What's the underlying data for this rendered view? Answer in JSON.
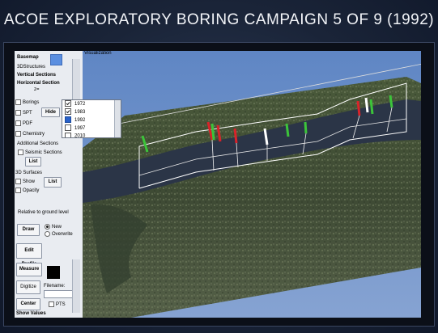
{
  "slide_title": "ACOE EXPLORATORY BORING CAMPAIGN 5  OF 9  (1992)",
  "view": {
    "title": "Visualization"
  },
  "panel": {
    "basemap": "Basemap",
    "structures3d": "3DStructures",
    "vertical_sections": "Vertical Sections",
    "horizontal_section": "Horizontal Section",
    "z_label": "z=",
    "borings": "Borings",
    "spt": "SPT",
    "hide": "Hide",
    "pdf": "PDF",
    "chemistry": "Chemistry",
    "additional_sections": "Additional Sections",
    "seismic_sections": "Seismic Sections",
    "list1": "List",
    "surfaces_3d": "3D Surfaces",
    "show": "Show",
    "list2": "List",
    "opacity": "Opacity",
    "relative": "Relative to ground level",
    "draw": "Draw",
    "new": "New",
    "overwrite": "Overwrite",
    "edit_profile": "Edit Profile",
    "measure": "Measure",
    "digitize": "Digitize",
    "filename": "Filename:",
    "center": "Center",
    "pts": "PTS",
    "show_values": "Show Values"
  },
  "years": [
    {
      "label": "1972",
      "checked": true
    },
    {
      "label": "1983",
      "checked": true
    },
    {
      "label": "1992",
      "checked": true
    },
    {
      "label": "1997",
      "checked": false
    },
    {
      "label": "2010",
      "checked": false
    }
  ],
  "colors": {
    "panel_bg": "#e9ecf1",
    "sky": "#6f8fbf",
    "water": "#2b3547",
    "boring_red": "#d8232a",
    "boring_green": "#3cc43a"
  }
}
